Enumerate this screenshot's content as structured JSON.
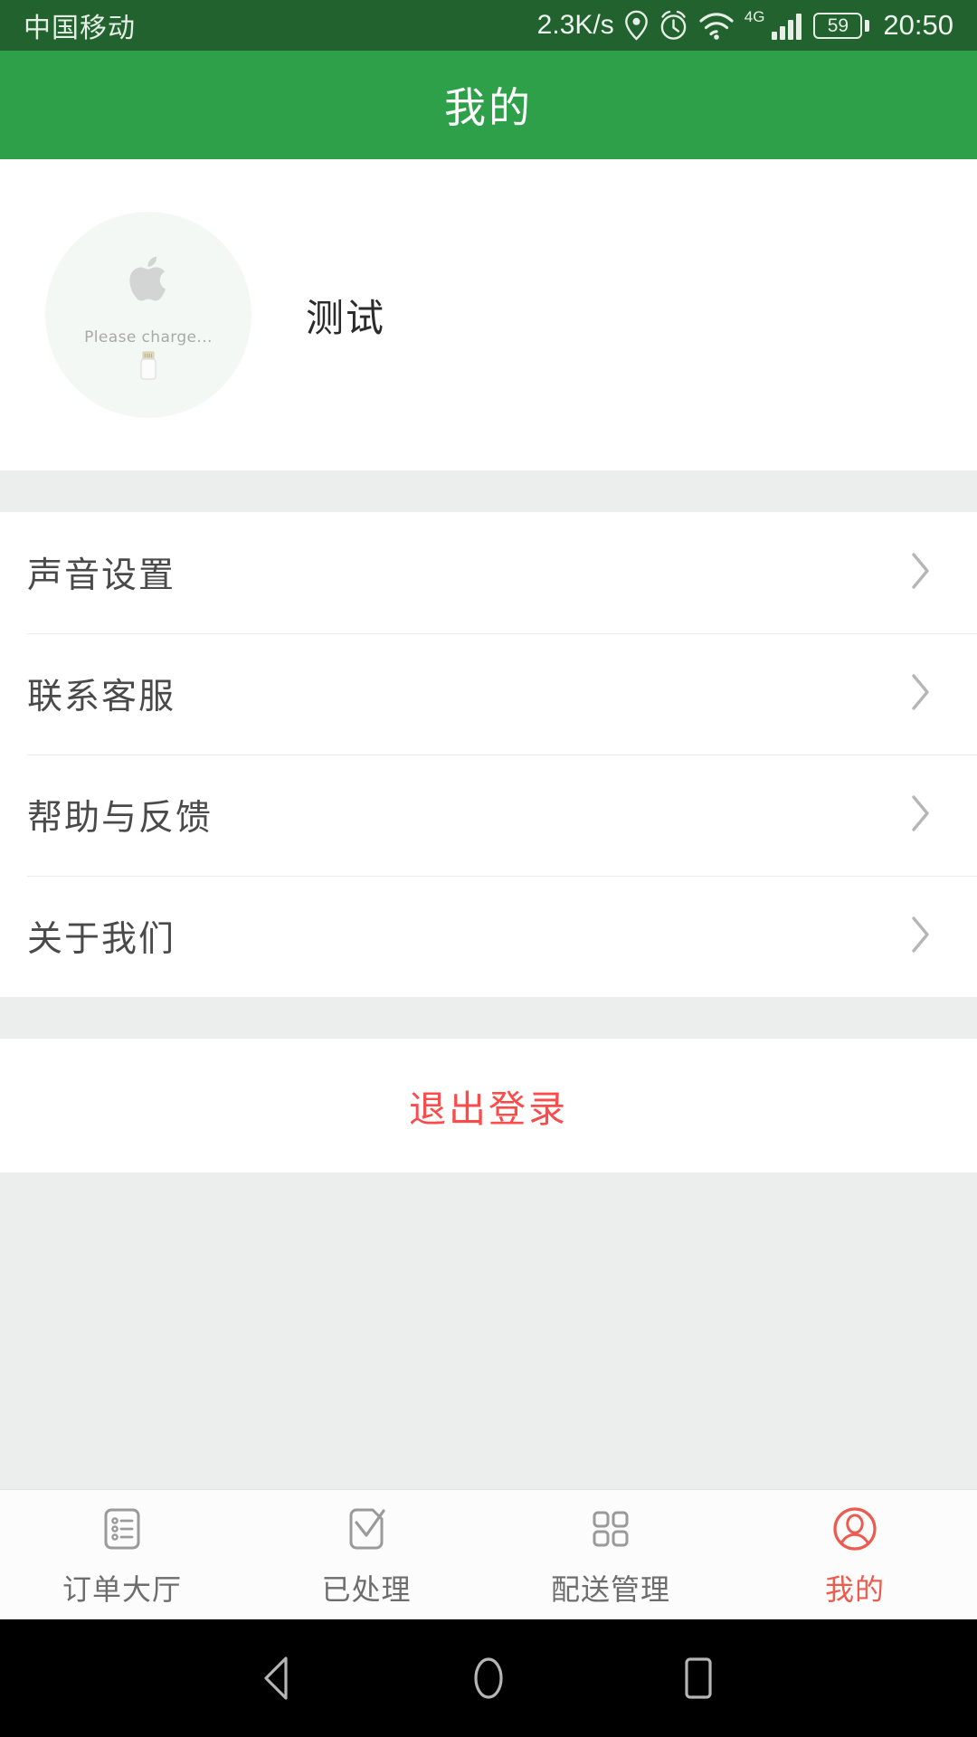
{
  "status_bar": {
    "carrier": "中国移动",
    "net_speed": "2.3K/s",
    "icons": [
      "location-icon",
      "alarm-icon",
      "wifi-icon",
      "network-4g-icon",
      "signal-bars-icon"
    ],
    "network_type": "4G",
    "battery_level": "59",
    "time": "20:50",
    "background_color": "#22622f",
    "text_color": "#e6eee6"
  },
  "header": {
    "title": "我的",
    "background_color": "#2fa04a",
    "text_color": "#ffffff"
  },
  "profile": {
    "avatar_name": "avatar",
    "avatar_caption": "Please charge...",
    "avatar_logo": "apple-logo-icon",
    "avatar_connector": "lightning-connector-icon",
    "username": "测试"
  },
  "menu": {
    "items": [
      {
        "label": "声音设置",
        "name": "menu-item-sound-settings",
        "chevron": "chevron-right-icon"
      },
      {
        "label": "联系客服",
        "name": "menu-item-contact-support",
        "chevron": "chevron-right-icon"
      },
      {
        "label": "帮助与反馈",
        "name": "menu-item-help-feedback",
        "chevron": "chevron-right-icon"
      },
      {
        "label": "关于我们",
        "name": "menu-item-about-us",
        "chevron": "chevron-right-icon"
      }
    ]
  },
  "logout": {
    "label": "退出登录",
    "color": "#fb4b4b"
  },
  "tab_bar": {
    "active_color": "#ec5b4f",
    "inactive_color": "#6d6d6d",
    "tabs": [
      {
        "label": "订单大厅",
        "icon": "order-list-icon",
        "active": false
      },
      {
        "label": "已处理",
        "icon": "checked-document-icon",
        "active": false
      },
      {
        "label": "配送管理",
        "icon": "grid-squares-icon",
        "active": false
      },
      {
        "label": "我的",
        "icon": "user-circle-icon",
        "active": true
      }
    ]
  },
  "android_nav": {
    "buttons": [
      {
        "name": "back-button",
        "icon": "triangle-back-icon"
      },
      {
        "name": "home-button",
        "icon": "circle-home-icon"
      },
      {
        "name": "recents-button",
        "icon": "square-recents-icon"
      }
    ]
  }
}
